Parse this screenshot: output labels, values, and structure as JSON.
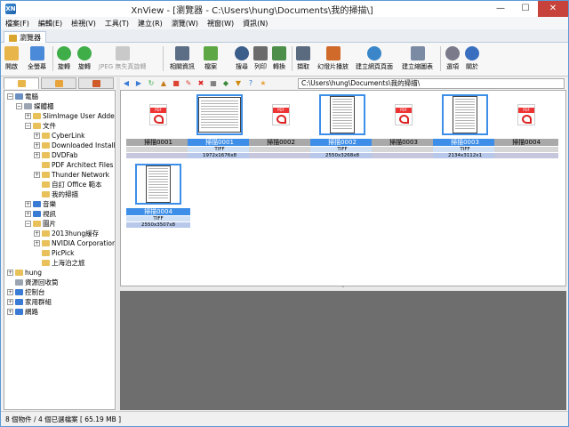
{
  "window": {
    "title": "XnView - [瀏覽器 - C:\\Users\\hung\\Documents\\我的掃描\\]",
    "app_icon": "XN"
  },
  "menu": [
    "檔案(F)",
    "編輯(E)",
    "檢視(V)",
    "工具(T)",
    "建立(R)",
    "瀏覽(W)",
    "視窗(W)",
    "資訊(N)"
  ],
  "tab": {
    "label": "瀏覽器"
  },
  "toolbar": {
    "open": "開啟",
    "fullscreen": "全螢幕",
    "rotate_left": "旋轉",
    "rotate_right": "旋轉",
    "jpeg_lossless": "JPEG 無失真旋轉",
    "properties": "相關資訊",
    "file": "檔案",
    "search": "搜尋",
    "print": "列印",
    "convert": "轉換",
    "capture": "擷取",
    "slideshow": "幻燈片播放",
    "web_page": "建立網頁頁面",
    "contact_sheet": "建立縮圖表",
    "options": "選項",
    "about": "關於"
  },
  "tree": {
    "items": [
      {
        "label": "電腦",
        "toggle": "⊟",
        "level": 0,
        "icon": "computer-icon"
      },
      {
        "label": "媒體櫃",
        "toggle": "⊟",
        "level": 1,
        "icon": "library-icon"
      },
      {
        "label": "SlimImage User Added",
        "toggle": "⊞",
        "level": 2,
        "icon": "folder-icon"
      },
      {
        "label": "文件",
        "toggle": "⊟",
        "level": 2,
        "icon": "folder-icon"
      },
      {
        "label": "CyberLink",
        "toggle": "⊞",
        "level": 3,
        "icon": "folder-icon"
      },
      {
        "label": "Downloaded Installe",
        "toggle": "⊞",
        "level": 3,
        "icon": "folder-icon"
      },
      {
        "label": "DVDFab",
        "toggle": "⊞",
        "level": 3,
        "icon": "folder-icon"
      },
      {
        "label": "PDF Architect Files",
        "toggle": "",
        "level": 3,
        "icon": "folder-icon"
      },
      {
        "label": "Thunder Network",
        "toggle": "⊞",
        "level": 3,
        "icon": "folder-icon"
      },
      {
        "label": "自訂 Office 範本",
        "toggle": "",
        "level": 3,
        "icon": "folder-icon"
      },
      {
        "label": "我的掃描",
        "toggle": "",
        "level": 3,
        "icon": "folder-icon"
      },
      {
        "label": "音樂",
        "toggle": "⊞",
        "level": 2,
        "icon": "music-icon"
      },
      {
        "label": "視訊",
        "toggle": "⊞",
        "level": 2,
        "icon": "video-icon"
      },
      {
        "label": "圖片",
        "toggle": "⊟",
        "level": 2,
        "icon": "pictures-icon"
      },
      {
        "label": "2013hung緩存",
        "toggle": "⊞",
        "level": 3,
        "icon": "folder-icon"
      },
      {
        "label": "NVIDIA Corporation",
        "toggle": "⊞",
        "level": 3,
        "icon": "folder-icon"
      },
      {
        "label": "PicPick",
        "toggle": "",
        "level": 3,
        "icon": "folder-icon"
      },
      {
        "label": "上海泊之旅",
        "toggle": "",
        "level": 3,
        "icon": "folder-icon"
      },
      {
        "label": "hung",
        "toggle": "⊞",
        "level": 0,
        "icon": "user-icon"
      },
      {
        "label": "資源回收筒",
        "toggle": "",
        "level": 0,
        "icon": "recycle-bin-icon"
      },
      {
        "label": "控制台",
        "toggle": "⊞",
        "level": 0,
        "icon": "control-panel-icon"
      },
      {
        "label": "家用群組",
        "toggle": "⊞",
        "level": 0,
        "icon": "homegroup-icon"
      },
      {
        "label": "網路",
        "toggle": "⊞",
        "level": 0,
        "icon": "network-icon"
      }
    ]
  },
  "path": "C:\\Users\\hung\\Documents\\我的掃描\\",
  "thumbnails": [
    {
      "name": "掃描0001",
      "kind": "pdf",
      "selected": false
    },
    {
      "name": "掃描0001",
      "kind": "land",
      "selected": true,
      "format": "TIFF",
      "dims": "1972x1676x8"
    },
    {
      "name": "掃描0002",
      "kind": "pdf",
      "selected": false
    },
    {
      "name": "掃描0002",
      "kind": "port",
      "selected": true,
      "format": "TIFF",
      "dims": "2550x3268x8"
    },
    {
      "name": "掃描0003",
      "kind": "pdf",
      "selected": false
    },
    {
      "name": "掃描0003",
      "kind": "port",
      "selected": true,
      "format": "TIFF",
      "dims": "2134x3112x1"
    },
    {
      "name": "掃描0004",
      "kind": "pdf",
      "selected": false
    },
    {
      "name": "掃描0004",
      "kind": "port",
      "selected": true,
      "format": "TIFF",
      "dims": "2550x3507x8"
    }
  ],
  "status": "8 個物件 / 4 個已選檔案  [ 65.19 MB ]",
  "colors": {
    "accent": "#3d8ee8",
    "close": "#c7423b",
    "preview_bg": "#6e6e6e"
  }
}
